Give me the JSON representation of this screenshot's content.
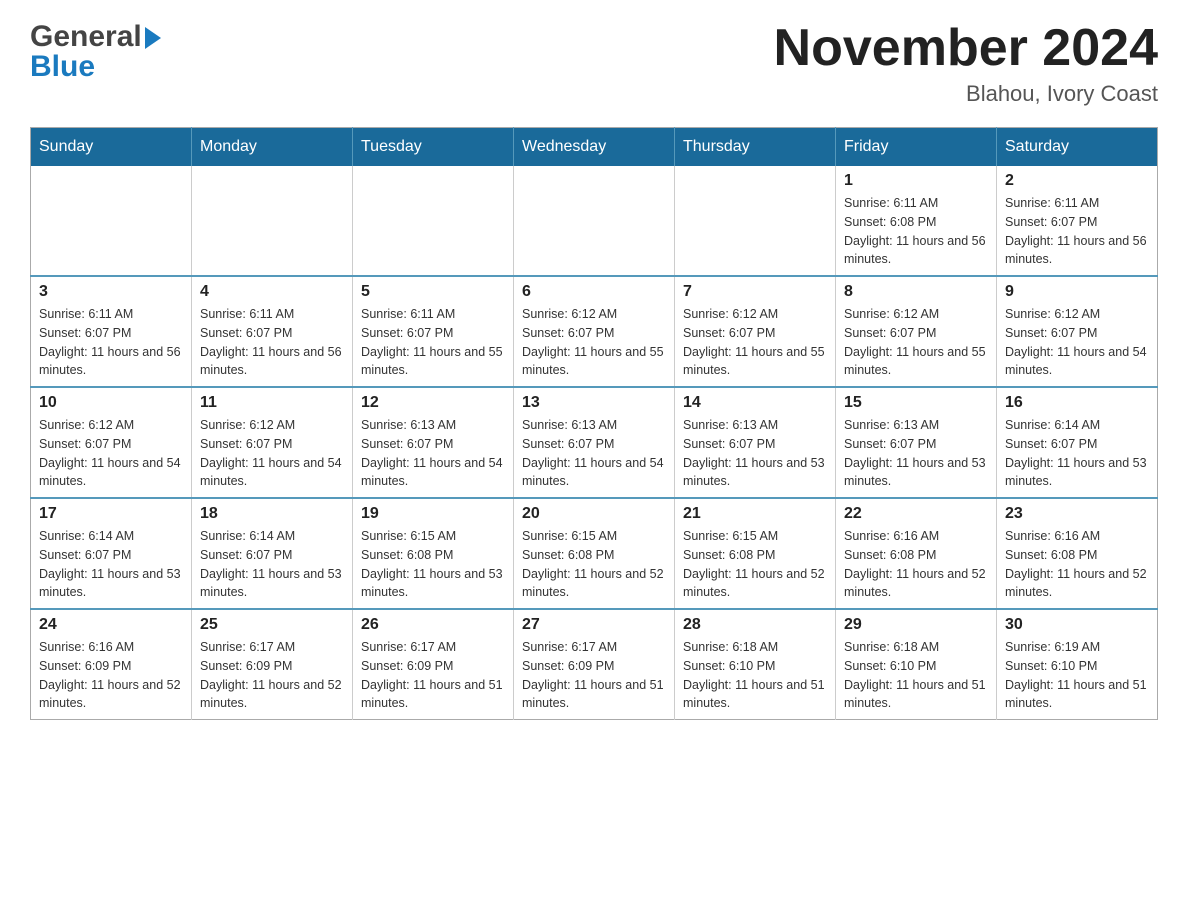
{
  "header": {
    "logo_general": "General",
    "logo_blue": "Blue",
    "month_title": "November 2024",
    "location": "Blahou, Ivory Coast"
  },
  "weekdays": [
    "Sunday",
    "Monday",
    "Tuesday",
    "Wednesday",
    "Thursday",
    "Friday",
    "Saturday"
  ],
  "weeks": [
    [
      {
        "day": "",
        "sunrise": "",
        "sunset": "",
        "daylight": ""
      },
      {
        "day": "",
        "sunrise": "",
        "sunset": "",
        "daylight": ""
      },
      {
        "day": "",
        "sunrise": "",
        "sunset": "",
        "daylight": ""
      },
      {
        "day": "",
        "sunrise": "",
        "sunset": "",
        "daylight": ""
      },
      {
        "day": "",
        "sunrise": "",
        "sunset": "",
        "daylight": ""
      },
      {
        "day": "1",
        "sunrise": "Sunrise: 6:11 AM",
        "sunset": "Sunset: 6:08 PM",
        "daylight": "Daylight: 11 hours and 56 minutes."
      },
      {
        "day": "2",
        "sunrise": "Sunrise: 6:11 AM",
        "sunset": "Sunset: 6:07 PM",
        "daylight": "Daylight: 11 hours and 56 minutes."
      }
    ],
    [
      {
        "day": "3",
        "sunrise": "Sunrise: 6:11 AM",
        "sunset": "Sunset: 6:07 PM",
        "daylight": "Daylight: 11 hours and 56 minutes."
      },
      {
        "day": "4",
        "sunrise": "Sunrise: 6:11 AM",
        "sunset": "Sunset: 6:07 PM",
        "daylight": "Daylight: 11 hours and 56 minutes."
      },
      {
        "day": "5",
        "sunrise": "Sunrise: 6:11 AM",
        "sunset": "Sunset: 6:07 PM",
        "daylight": "Daylight: 11 hours and 55 minutes."
      },
      {
        "day": "6",
        "sunrise": "Sunrise: 6:12 AM",
        "sunset": "Sunset: 6:07 PM",
        "daylight": "Daylight: 11 hours and 55 minutes."
      },
      {
        "day": "7",
        "sunrise": "Sunrise: 6:12 AM",
        "sunset": "Sunset: 6:07 PM",
        "daylight": "Daylight: 11 hours and 55 minutes."
      },
      {
        "day": "8",
        "sunrise": "Sunrise: 6:12 AM",
        "sunset": "Sunset: 6:07 PM",
        "daylight": "Daylight: 11 hours and 55 minutes."
      },
      {
        "day": "9",
        "sunrise": "Sunrise: 6:12 AM",
        "sunset": "Sunset: 6:07 PM",
        "daylight": "Daylight: 11 hours and 54 minutes."
      }
    ],
    [
      {
        "day": "10",
        "sunrise": "Sunrise: 6:12 AM",
        "sunset": "Sunset: 6:07 PM",
        "daylight": "Daylight: 11 hours and 54 minutes."
      },
      {
        "day": "11",
        "sunrise": "Sunrise: 6:12 AM",
        "sunset": "Sunset: 6:07 PM",
        "daylight": "Daylight: 11 hours and 54 minutes."
      },
      {
        "day": "12",
        "sunrise": "Sunrise: 6:13 AM",
        "sunset": "Sunset: 6:07 PM",
        "daylight": "Daylight: 11 hours and 54 minutes."
      },
      {
        "day": "13",
        "sunrise": "Sunrise: 6:13 AM",
        "sunset": "Sunset: 6:07 PM",
        "daylight": "Daylight: 11 hours and 54 minutes."
      },
      {
        "day": "14",
        "sunrise": "Sunrise: 6:13 AM",
        "sunset": "Sunset: 6:07 PM",
        "daylight": "Daylight: 11 hours and 53 minutes."
      },
      {
        "day": "15",
        "sunrise": "Sunrise: 6:13 AM",
        "sunset": "Sunset: 6:07 PM",
        "daylight": "Daylight: 11 hours and 53 minutes."
      },
      {
        "day": "16",
        "sunrise": "Sunrise: 6:14 AM",
        "sunset": "Sunset: 6:07 PM",
        "daylight": "Daylight: 11 hours and 53 minutes."
      }
    ],
    [
      {
        "day": "17",
        "sunrise": "Sunrise: 6:14 AM",
        "sunset": "Sunset: 6:07 PM",
        "daylight": "Daylight: 11 hours and 53 minutes."
      },
      {
        "day": "18",
        "sunrise": "Sunrise: 6:14 AM",
        "sunset": "Sunset: 6:07 PM",
        "daylight": "Daylight: 11 hours and 53 minutes."
      },
      {
        "day": "19",
        "sunrise": "Sunrise: 6:15 AM",
        "sunset": "Sunset: 6:08 PM",
        "daylight": "Daylight: 11 hours and 53 minutes."
      },
      {
        "day": "20",
        "sunrise": "Sunrise: 6:15 AM",
        "sunset": "Sunset: 6:08 PM",
        "daylight": "Daylight: 11 hours and 52 minutes."
      },
      {
        "day": "21",
        "sunrise": "Sunrise: 6:15 AM",
        "sunset": "Sunset: 6:08 PM",
        "daylight": "Daylight: 11 hours and 52 minutes."
      },
      {
        "day": "22",
        "sunrise": "Sunrise: 6:16 AM",
        "sunset": "Sunset: 6:08 PM",
        "daylight": "Daylight: 11 hours and 52 minutes."
      },
      {
        "day": "23",
        "sunrise": "Sunrise: 6:16 AM",
        "sunset": "Sunset: 6:08 PM",
        "daylight": "Daylight: 11 hours and 52 minutes."
      }
    ],
    [
      {
        "day": "24",
        "sunrise": "Sunrise: 6:16 AM",
        "sunset": "Sunset: 6:09 PM",
        "daylight": "Daylight: 11 hours and 52 minutes."
      },
      {
        "day": "25",
        "sunrise": "Sunrise: 6:17 AM",
        "sunset": "Sunset: 6:09 PM",
        "daylight": "Daylight: 11 hours and 52 minutes."
      },
      {
        "day": "26",
        "sunrise": "Sunrise: 6:17 AM",
        "sunset": "Sunset: 6:09 PM",
        "daylight": "Daylight: 11 hours and 51 minutes."
      },
      {
        "day": "27",
        "sunrise": "Sunrise: 6:17 AM",
        "sunset": "Sunset: 6:09 PM",
        "daylight": "Daylight: 11 hours and 51 minutes."
      },
      {
        "day": "28",
        "sunrise": "Sunrise: 6:18 AM",
        "sunset": "Sunset: 6:10 PM",
        "daylight": "Daylight: 11 hours and 51 minutes."
      },
      {
        "day": "29",
        "sunrise": "Sunrise: 6:18 AM",
        "sunset": "Sunset: 6:10 PM",
        "daylight": "Daylight: 11 hours and 51 minutes."
      },
      {
        "day": "30",
        "sunrise": "Sunrise: 6:19 AM",
        "sunset": "Sunset: 6:10 PM",
        "daylight": "Daylight: 11 hours and 51 minutes."
      }
    ]
  ]
}
